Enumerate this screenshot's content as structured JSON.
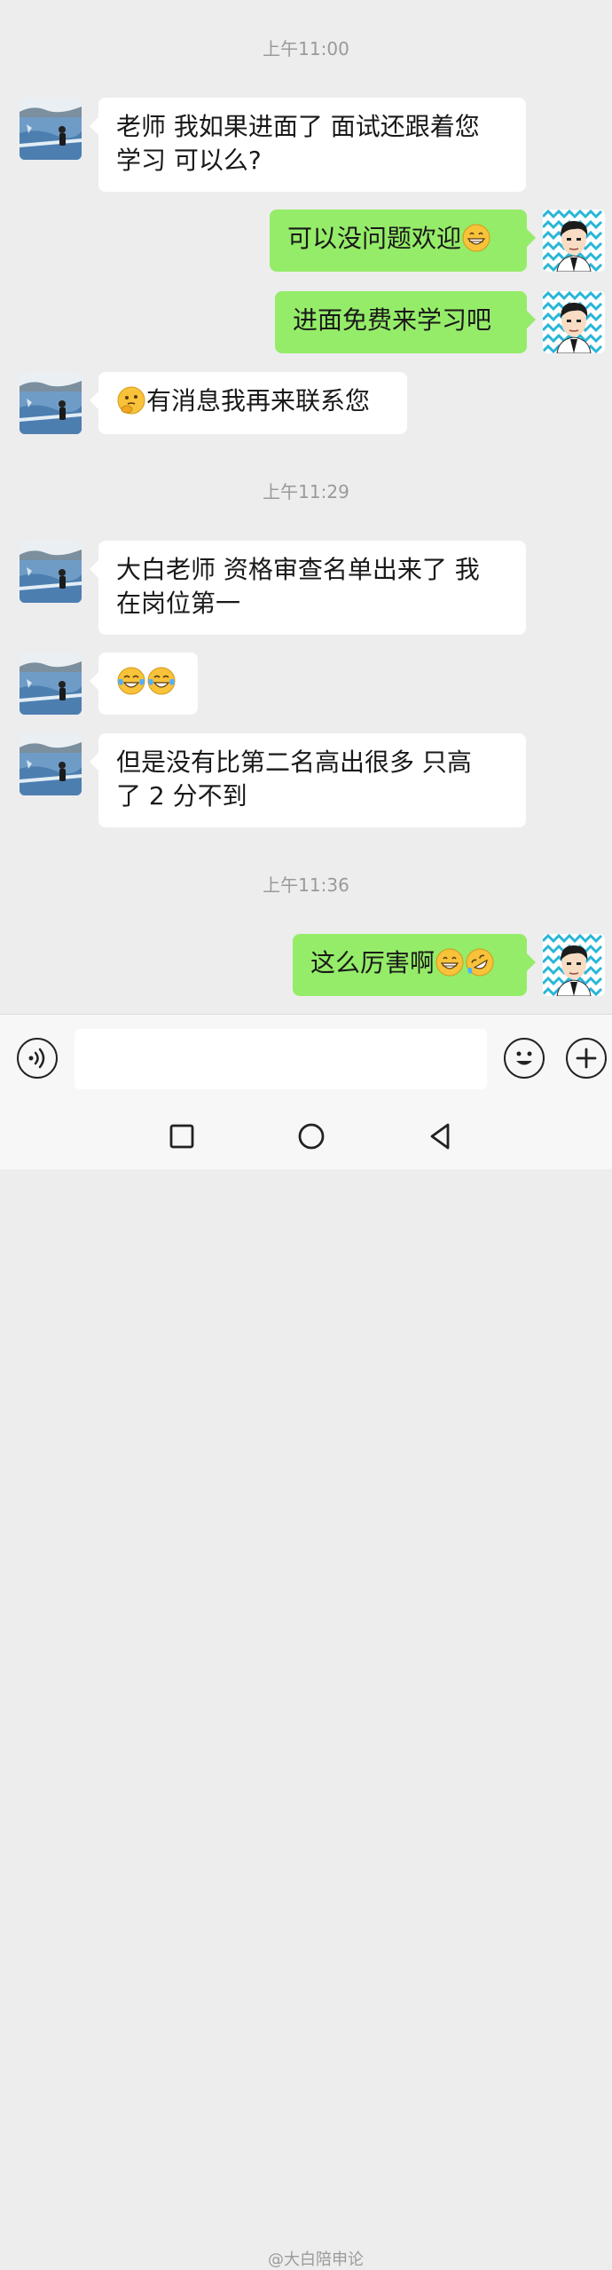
{
  "timestamps": [
    "上午11:00",
    "上午11:29",
    "上午11:36"
  ],
  "messages": [
    {
      "side": "in",
      "line1": "老师  我如果进面了  面试还跟着您",
      "line2": "学习  可以么?"
    },
    {
      "side": "out",
      "text": "可以没问题欢迎",
      "emoji": "grin-emoji"
    },
    {
      "side": "out",
      "text": "进面免费来学习吧"
    },
    {
      "side": "in",
      "emoji": "thinking-emoji",
      "text": "有消息我再来联系您"
    },
    {
      "side": "in",
      "line1": "大白老师  资格审查名单出来了  我",
      "line2": "在岗位第一"
    },
    {
      "side": "in",
      "emojis": [
        "tears-of-joy-emoji",
        "tears-of-joy-emoji"
      ]
    },
    {
      "side": "in",
      "line1": "但是没有比第二名高出很多  只高",
      "line2": "了 2 分不到"
    },
    {
      "side": "out",
      "text": "这么厉害啊",
      "emojis": [
        "grin-emoji",
        "rofl-emoji"
      ]
    }
  ],
  "input_bar": {
    "placeholder": "",
    "icons": [
      "voice-icon",
      "emoji-icon",
      "plus-icon"
    ]
  },
  "nav_bar": {
    "icons": [
      "recent-apps-icon",
      "home-icon",
      "back-icon"
    ]
  },
  "watermark": "@大白陪申论",
  "colors": {
    "background": "#ededed",
    "incoming_bubble": "#ffffff",
    "outgoing_bubble": "#95ec69",
    "timestamp": "#9a9a9a"
  }
}
